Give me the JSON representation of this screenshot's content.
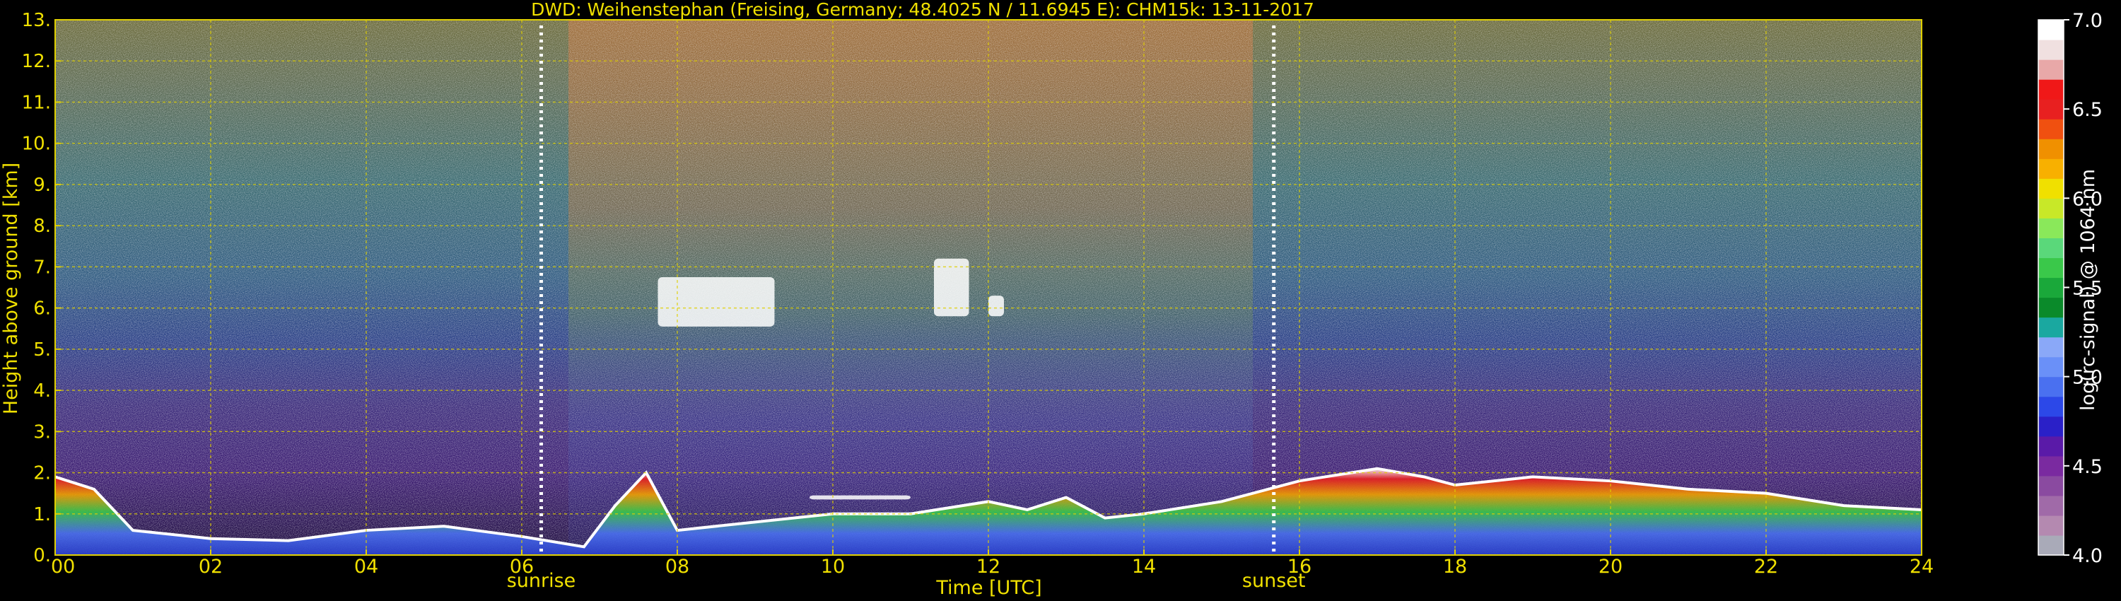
{
  "chart_data": {
    "type": "heatmap",
    "title": "DWD: Weihenstephan (Freising, Germany; 48.4025 N / 11.6945 E):    CHM15k: 13-11-2017",
    "xlabel": "Time [UTC]",
    "ylabel": "Height above ground [km]",
    "xlim": [
      0,
      24
    ],
    "ylim": [
      0,
      13
    ],
    "x_ticks": [
      0,
      2,
      4,
      6,
      8,
      10,
      12,
      14,
      16,
      18,
      20,
      22,
      24
    ],
    "x_tick_labels": [
      "00",
      "02",
      "04",
      "06",
      "08",
      "10",
      "12",
      "14",
      "16",
      "18",
      "20",
      "22",
      "24"
    ],
    "y_ticks": [
      0,
      1,
      2,
      3,
      4,
      5,
      6,
      7,
      8,
      9,
      10,
      11,
      12,
      13
    ],
    "y_tick_labels": [
      "0.",
      "1.",
      "2.",
      "3.",
      "4.",
      "5.",
      "6.",
      "7.",
      "8.",
      "9.",
      "10.",
      "11.",
      "12.",
      "13."
    ],
    "grid": true,
    "markers": [
      {
        "label": "sunrise",
        "x": 6.25
      },
      {
        "label": "sunset",
        "x": 15.67
      }
    ],
    "colorbar": {
      "label": "log(rc-signal) @ 1064 nm",
      "range": [
        4.0,
        7.0
      ],
      "ticks": [
        4.0,
        4.5,
        5.0,
        5.5,
        6.0,
        6.5,
        7.0
      ],
      "tick_labels": [
        "4.0",
        "4.5",
        "5.0",
        "5.5",
        "6.0",
        "6.5",
        "7.0"
      ],
      "colors": [
        "#a9aab8",
        "#b489b0",
        "#a06aa8",
        "#8a4aa0",
        "#7a2aa0",
        "#5a1aa8",
        "#2a20c8",
        "#2c48e8",
        "#4a70f0",
        "#6a90f8",
        "#8aa8f8",
        "#1aa8a0",
        "#0a8a2a",
        "#1aa83a",
        "#3ac84a",
        "#5ad87a",
        "#8ae85a",
        "#c8e828",
        "#f0e000",
        "#f8b000",
        "#f09000",
        "#f05010",
        "#e82020",
        "#f01818",
        "#e8a8a8",
        "#f0e0e0",
        "#ffffff"
      ]
    },
    "layers": {
      "boundary_layer_top_km": [
        [
          0,
          1.9
        ],
        [
          0.5,
          1.6
        ],
        [
          1,
          0.6
        ],
        [
          2,
          0.4
        ],
        [
          3,
          0.35
        ],
        [
          4,
          0.6
        ],
        [
          5,
          0.7
        ],
        [
          6,
          0.45
        ],
        [
          6.8,
          0.2
        ],
        [
          7.2,
          1.2
        ],
        [
          7.6,
          2.0
        ],
        [
          8,
          0.6
        ],
        [
          9,
          0.8
        ],
        [
          10,
          1.0
        ],
        [
          11,
          1.0
        ],
        [
          12,
          1.3
        ],
        [
          12.5,
          1.1
        ],
        [
          13,
          1.4
        ],
        [
          13.5,
          0.9
        ],
        [
          14,
          1.0
        ],
        [
          15,
          1.3
        ],
        [
          16,
          1.8
        ],
        [
          17,
          2.1
        ],
        [
          17.6,
          1.9
        ],
        [
          18,
          1.7
        ],
        [
          19,
          1.9
        ],
        [
          20,
          1.8
        ],
        [
          21,
          1.6
        ],
        [
          22,
          1.5
        ],
        [
          23,
          1.2
        ],
        [
          24,
          1.1
        ]
      ],
      "cloud_patches": [
        {
          "x": [
            7.75,
            9.25
          ],
          "y": [
            5.55,
            6.75
          ]
        },
        {
          "x": [
            11.3,
            11.75
          ],
          "y": [
            5.8,
            7.2
          ]
        },
        {
          "x": [
            12.0,
            12.2
          ],
          "y": [
            5.8,
            6.3
          ]
        },
        {
          "x": [
            9.7,
            11.0
          ],
          "y": [
            1.35,
            1.45
          ]
        }
      ]
    }
  }
}
